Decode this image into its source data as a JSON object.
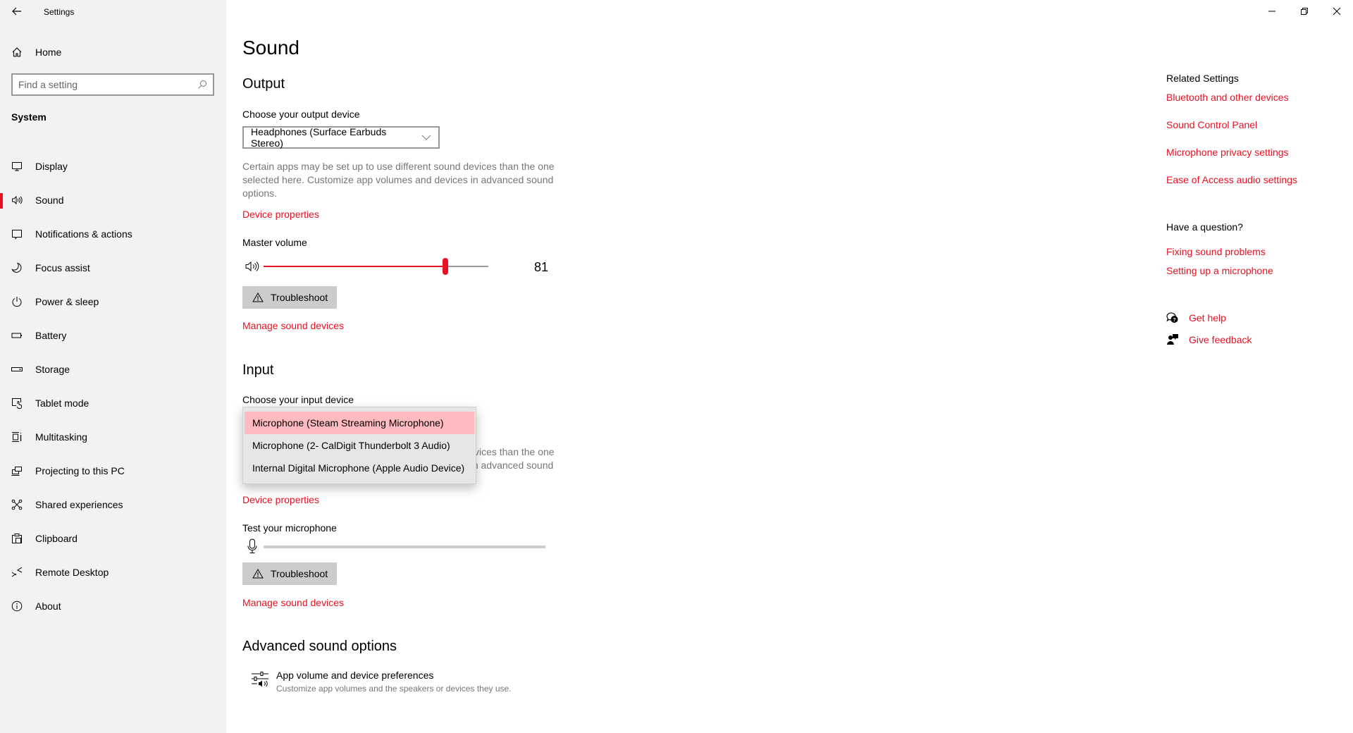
{
  "window": {
    "title": "Settings",
    "controls": [
      "minimize",
      "restore",
      "close"
    ]
  },
  "sidebar": {
    "home_label": "Home",
    "search_placeholder": "Find a setting",
    "section": "System",
    "items": [
      {
        "label": "Display",
        "icon": "monitor-icon"
      },
      {
        "label": "Sound",
        "icon": "speaker-icon",
        "active": true
      },
      {
        "label": "Notifications & actions",
        "icon": "notification-icon"
      },
      {
        "label": "Focus assist",
        "icon": "moon-icon"
      },
      {
        "label": "Power & sleep",
        "icon": "power-icon"
      },
      {
        "label": "Battery",
        "icon": "battery-icon"
      },
      {
        "label": "Storage",
        "icon": "storage-icon"
      },
      {
        "label": "Tablet mode",
        "icon": "tablet-mode-icon"
      },
      {
        "label": "Multitasking",
        "icon": "multitasking-icon"
      },
      {
        "label": "Projecting to this PC",
        "icon": "projecting-icon"
      },
      {
        "label": "Shared experiences",
        "icon": "shared-experiences-icon"
      },
      {
        "label": "Clipboard",
        "icon": "clipboard-icon"
      },
      {
        "label": "Remote Desktop",
        "icon": "remote-desktop-icon"
      },
      {
        "label": "About",
        "icon": "info-icon"
      }
    ]
  },
  "main": {
    "title": "Sound",
    "output": {
      "heading": "Output",
      "device_label": "Choose your output device",
      "device_value": "Headphones (Surface Earbuds Stereo)",
      "description": "Certain apps may be set up to use different sound devices than the one selected here. Customize app volumes and devices in advanced sound options.",
      "device_properties_link": "Device properties",
      "volume_label": "Master volume",
      "volume_value": 81,
      "volume_value_text": "81",
      "troubleshoot_label": "Troubleshoot",
      "manage_link": "Manage sound devices"
    },
    "input": {
      "heading": "Input",
      "device_label": "Choose your input device",
      "dropdown_options": [
        {
          "label": "Microphone (Steam Streaming Microphone)",
          "selected": true
        },
        {
          "label": "Microphone (2- CalDigit Thunderbolt 3 Audio)",
          "selected": false
        },
        {
          "label": "Internal Digital Microphone (Apple Audio Device)",
          "selected": false
        }
      ],
      "description": "Certain apps may be set up to use different sound devices than the one selected here. Customize app volumes and devices in advanced sound options.",
      "device_properties_link": "Device properties",
      "test_label": "Test your microphone",
      "mic_level": 0,
      "troubleshoot_label": "Troubleshoot",
      "manage_link": "Manage sound devices"
    },
    "advanced": {
      "heading": "Advanced sound options",
      "item_title": "App volume and device preferences",
      "item_subtitle": "Customize app volumes and the speakers or devices they use."
    }
  },
  "related": {
    "heading": "Related Settings",
    "links": [
      "Bluetooth and other devices",
      "Sound Control Panel",
      "Microphone privacy settings",
      "Ease of Access audio settings"
    ],
    "question_heading": "Have a question?",
    "question_links": [
      "Fixing sound problems",
      "Setting up a microphone"
    ],
    "get_help": "Get help",
    "give_feedback": "Give feedback"
  },
  "colors": {
    "accent": "#e81123",
    "dropdown_selected": "#ffbbbf",
    "sidebar_bg": "#f2f2f2",
    "button_bg": "#cccccc"
  }
}
